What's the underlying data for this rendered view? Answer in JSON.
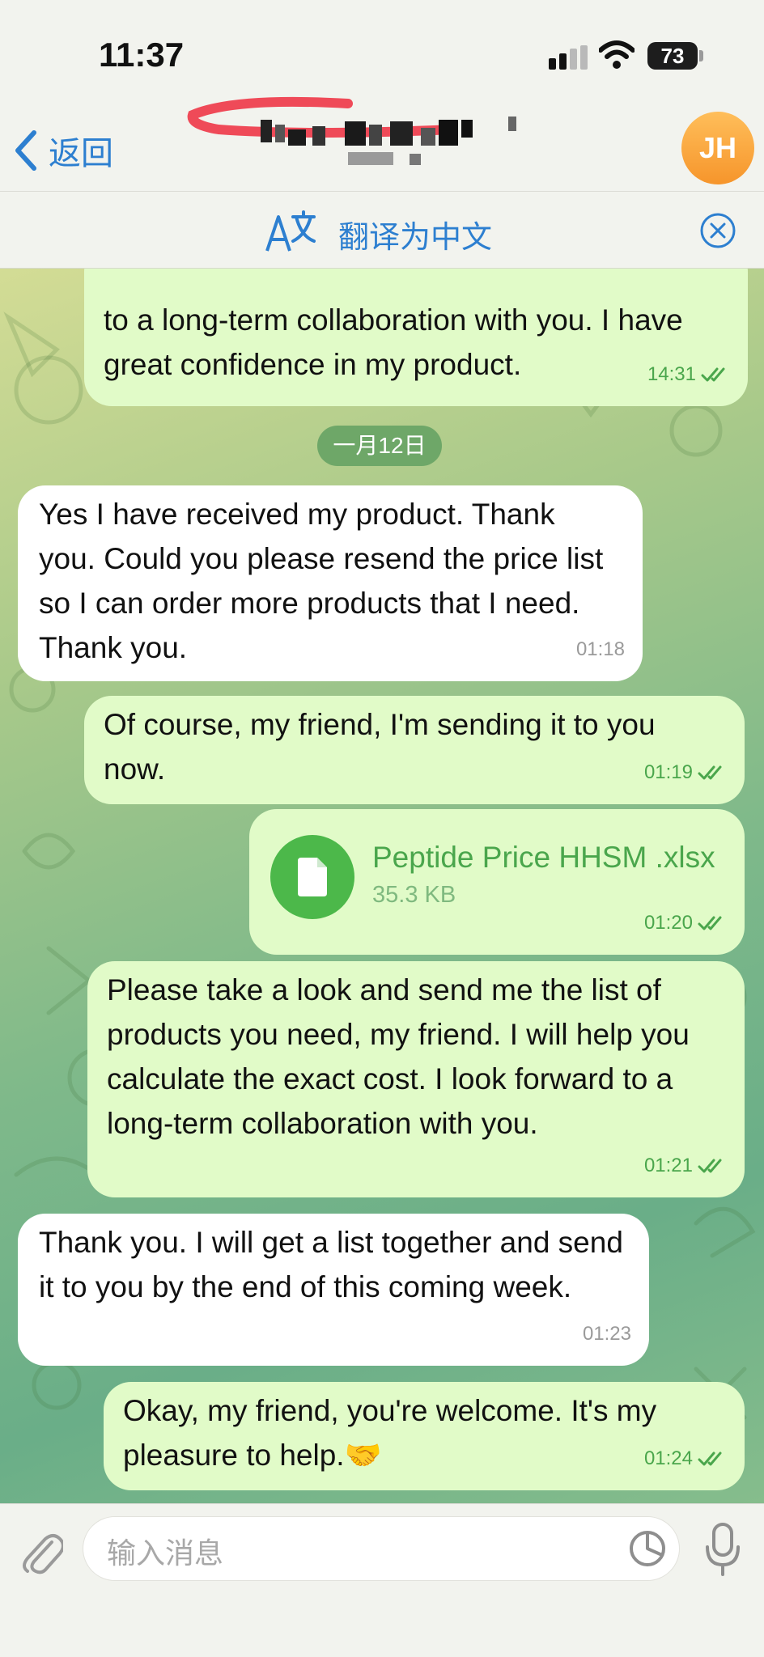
{
  "status_bar": {
    "time": "11:37",
    "battery": "73"
  },
  "nav": {
    "back_label": "返回",
    "avatar_initials": "JH",
    "avatar_colors": [
      "#ffbe5a",
      "#f6952b"
    ]
  },
  "translate_bar": {
    "label": "翻译为中文",
    "icon": "translate-icon",
    "close_icon": "close-circle-icon"
  },
  "messages": [
    {
      "direction": "out",
      "text": "to a long-term collaboration with you. I have great confidence in my product.",
      "time": "14:31",
      "status": "read"
    },
    {
      "type": "date",
      "text": "一月12日"
    },
    {
      "direction": "in",
      "text": "Yes I have received my product. Thank you. Could you please resend the price list so I can order more products that I need. Thank you.",
      "time": "01:18"
    },
    {
      "direction": "out",
      "text": "Of course, my friend, I'm sending it to you now.",
      "time": "01:19",
      "status": "read"
    },
    {
      "direction": "out",
      "type": "file",
      "file_name": "Peptide Price HHSM .xlsx",
      "file_size": "35.3 KB",
      "time": "01:20",
      "status": "read"
    },
    {
      "direction": "out",
      "text": "Please take a look and send me the list of products you need, my friend. I will help you calculate the exact cost. I look forward to a long-term collaboration with you.",
      "time": "01:21",
      "status": "read"
    },
    {
      "direction": "in",
      "text": "Thank you. I will get a list together and send it to you by the end of this coming week.",
      "time": "01:23"
    },
    {
      "direction": "out",
      "text": "Okay, my friend, you're welcome. It's my pleasure to help.🤝",
      "time": "01:24",
      "status": "read"
    }
  ],
  "composer": {
    "placeholder": "输入消息",
    "icons": [
      "paperclip-icon",
      "sticker-icon",
      "microphone-icon"
    ]
  },
  "colors": {
    "accent": "#2d7fd0",
    "outgoing_bubble": "#e1fbc8",
    "incoming_bubble": "#ffffff",
    "read_tick": "#4aa64c"
  }
}
